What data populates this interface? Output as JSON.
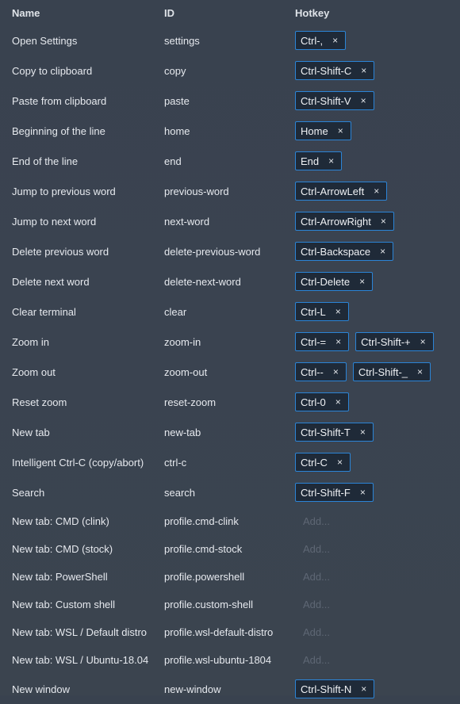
{
  "header": {
    "name": "Name",
    "id": "ID",
    "hotkey": "Hotkey"
  },
  "add_label": "Add...",
  "remove_glyph": "×",
  "rows": [
    {
      "name": "Open Settings",
      "id": "settings",
      "hotkeys": [
        "Ctrl-,"
      ]
    },
    {
      "name": "Copy to clipboard",
      "id": "copy",
      "hotkeys": [
        "Ctrl-Shift-C"
      ]
    },
    {
      "name": "Paste from clipboard",
      "id": "paste",
      "hotkeys": [
        "Ctrl-Shift-V"
      ]
    },
    {
      "name": "Beginning of the line",
      "id": "home",
      "hotkeys": [
        "Home"
      ]
    },
    {
      "name": "End of the line",
      "id": "end",
      "hotkeys": [
        "End"
      ]
    },
    {
      "name": "Jump to previous word",
      "id": "previous-word",
      "hotkeys": [
        "Ctrl-ArrowLeft"
      ]
    },
    {
      "name": "Jump to next word",
      "id": "next-word",
      "hotkeys": [
        "Ctrl-ArrowRight"
      ]
    },
    {
      "name": "Delete previous word",
      "id": "delete-previous-word",
      "hotkeys": [
        "Ctrl-Backspace"
      ]
    },
    {
      "name": "Delete next word",
      "id": "delete-next-word",
      "hotkeys": [
        "Ctrl-Delete"
      ]
    },
    {
      "name": "Clear terminal",
      "id": "clear",
      "hotkeys": [
        "Ctrl-L"
      ]
    },
    {
      "name": "Zoom in",
      "id": "zoom-in",
      "hotkeys": [
        "Ctrl-=",
        "Ctrl-Shift-+"
      ]
    },
    {
      "name": "Zoom out",
      "id": "zoom-out",
      "hotkeys": [
        "Ctrl--",
        "Ctrl-Shift-_"
      ]
    },
    {
      "name": "Reset zoom",
      "id": "reset-zoom",
      "hotkeys": [
        "Ctrl-0"
      ]
    },
    {
      "name": "New tab",
      "id": "new-tab",
      "hotkeys": [
        "Ctrl-Shift-T"
      ]
    },
    {
      "name": "Intelligent Ctrl-C (copy/abort)",
      "id": "ctrl-c",
      "hotkeys": [
        "Ctrl-C"
      ]
    },
    {
      "name": "Search",
      "id": "search",
      "hotkeys": [
        "Ctrl-Shift-F"
      ]
    },
    {
      "name": "New tab: CMD (clink)",
      "id": "profile.cmd-clink",
      "hotkeys": []
    },
    {
      "name": "New tab: CMD (stock)",
      "id": "profile.cmd-stock",
      "hotkeys": []
    },
    {
      "name": "New tab: PowerShell",
      "id": "profile.powershell",
      "hotkeys": []
    },
    {
      "name": "New tab: Custom shell",
      "id": "profile.custom-shell",
      "hotkeys": []
    },
    {
      "name": "New tab: WSL / Default distro",
      "id": "profile.wsl-default-distro",
      "hotkeys": []
    },
    {
      "name": "New tab: WSL / Ubuntu-18.04",
      "id": "profile.wsl-ubuntu-1804",
      "hotkeys": []
    },
    {
      "name": "New window",
      "id": "new-window",
      "hotkeys": [
        "Ctrl-Shift-N"
      ]
    }
  ]
}
